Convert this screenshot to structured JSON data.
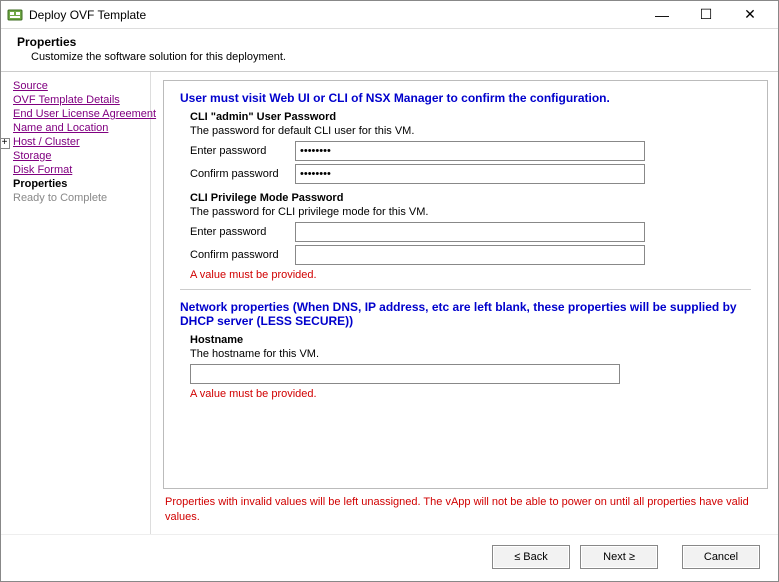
{
  "window": {
    "title": "Deploy OVF Template"
  },
  "header": {
    "title": "Properties",
    "desc": "Customize the software solution for this deployment."
  },
  "sidebar": {
    "items": [
      {
        "label": "Source"
      },
      {
        "label": "OVF Template Details"
      },
      {
        "label": "End User License Agreement"
      },
      {
        "label": "Name and Location"
      },
      {
        "label": "Host / Cluster"
      },
      {
        "label": "Storage"
      },
      {
        "label": "Disk Format"
      },
      {
        "label": "Properties"
      },
      {
        "label": "Ready to Complete"
      }
    ]
  },
  "content": {
    "section1_heading": "User must visit Web UI or CLI of NSX Manager to confirm the configuration.",
    "admin_pw": {
      "title": "CLI \"admin\" User Password",
      "desc": "The password for default CLI user for this VM.",
      "enter_label": "Enter password",
      "confirm_label": "Confirm password",
      "enter_value": "********",
      "confirm_value": "********"
    },
    "priv_pw": {
      "title": "CLI Privilege Mode Password",
      "desc": "The password for CLI privilege mode for this VM.",
      "enter_label": "Enter password",
      "confirm_label": "Confirm password",
      "enter_value": "",
      "confirm_value": ""
    },
    "err_value": "A value must be provided.",
    "section2_heading": "Network properties (When DNS, IP address, etc are left blank, these properties will be supplied by DHCP server (LESS SECURE))",
    "hostname": {
      "title": "Hostname",
      "desc": "The hostname for this VM.",
      "value": ""
    },
    "footer_warn": "Properties with invalid values will be left unassigned. The vApp will not be able to power on until all properties have valid values."
  },
  "buttons": {
    "back": "≤ Back",
    "next": "Next ≥",
    "cancel": "Cancel"
  }
}
